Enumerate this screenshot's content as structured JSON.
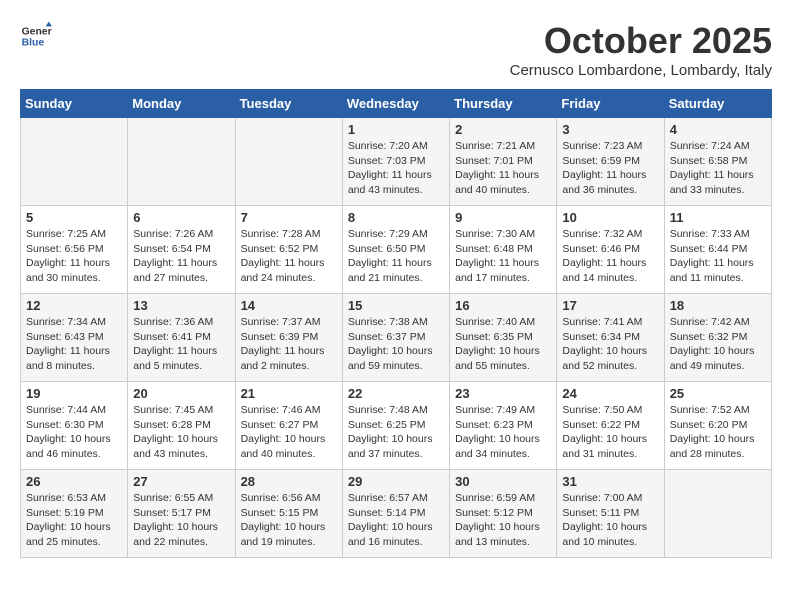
{
  "header": {
    "logo_line1": "General",
    "logo_line2": "Blue",
    "month": "October 2025",
    "location": "Cernusco Lombardone, Lombardy, Italy"
  },
  "days_of_week": [
    "Sunday",
    "Monday",
    "Tuesday",
    "Wednesday",
    "Thursday",
    "Friday",
    "Saturday"
  ],
  "weeks": [
    [
      {
        "day": "",
        "content": ""
      },
      {
        "day": "",
        "content": ""
      },
      {
        "day": "",
        "content": ""
      },
      {
        "day": "1",
        "content": "Sunrise: 7:20 AM\nSunset: 7:03 PM\nDaylight: 11 hours\nand 43 minutes."
      },
      {
        "day": "2",
        "content": "Sunrise: 7:21 AM\nSunset: 7:01 PM\nDaylight: 11 hours\nand 40 minutes."
      },
      {
        "day": "3",
        "content": "Sunrise: 7:23 AM\nSunset: 6:59 PM\nDaylight: 11 hours\nand 36 minutes."
      },
      {
        "day": "4",
        "content": "Sunrise: 7:24 AM\nSunset: 6:58 PM\nDaylight: 11 hours\nand 33 minutes."
      }
    ],
    [
      {
        "day": "5",
        "content": "Sunrise: 7:25 AM\nSunset: 6:56 PM\nDaylight: 11 hours\nand 30 minutes."
      },
      {
        "day": "6",
        "content": "Sunrise: 7:26 AM\nSunset: 6:54 PM\nDaylight: 11 hours\nand 27 minutes."
      },
      {
        "day": "7",
        "content": "Sunrise: 7:28 AM\nSunset: 6:52 PM\nDaylight: 11 hours\nand 24 minutes."
      },
      {
        "day": "8",
        "content": "Sunrise: 7:29 AM\nSunset: 6:50 PM\nDaylight: 11 hours\nand 21 minutes."
      },
      {
        "day": "9",
        "content": "Sunrise: 7:30 AM\nSunset: 6:48 PM\nDaylight: 11 hours\nand 17 minutes."
      },
      {
        "day": "10",
        "content": "Sunrise: 7:32 AM\nSunset: 6:46 PM\nDaylight: 11 hours\nand 14 minutes."
      },
      {
        "day": "11",
        "content": "Sunrise: 7:33 AM\nSunset: 6:44 PM\nDaylight: 11 hours\nand 11 minutes."
      }
    ],
    [
      {
        "day": "12",
        "content": "Sunrise: 7:34 AM\nSunset: 6:43 PM\nDaylight: 11 hours\nand 8 minutes."
      },
      {
        "day": "13",
        "content": "Sunrise: 7:36 AM\nSunset: 6:41 PM\nDaylight: 11 hours\nand 5 minutes."
      },
      {
        "day": "14",
        "content": "Sunrise: 7:37 AM\nSunset: 6:39 PM\nDaylight: 11 hours\nand 2 minutes."
      },
      {
        "day": "15",
        "content": "Sunrise: 7:38 AM\nSunset: 6:37 PM\nDaylight: 10 hours\nand 59 minutes."
      },
      {
        "day": "16",
        "content": "Sunrise: 7:40 AM\nSunset: 6:35 PM\nDaylight: 10 hours\nand 55 minutes."
      },
      {
        "day": "17",
        "content": "Sunrise: 7:41 AM\nSunset: 6:34 PM\nDaylight: 10 hours\nand 52 minutes."
      },
      {
        "day": "18",
        "content": "Sunrise: 7:42 AM\nSunset: 6:32 PM\nDaylight: 10 hours\nand 49 minutes."
      }
    ],
    [
      {
        "day": "19",
        "content": "Sunrise: 7:44 AM\nSunset: 6:30 PM\nDaylight: 10 hours\nand 46 minutes."
      },
      {
        "day": "20",
        "content": "Sunrise: 7:45 AM\nSunset: 6:28 PM\nDaylight: 10 hours\nand 43 minutes."
      },
      {
        "day": "21",
        "content": "Sunrise: 7:46 AM\nSunset: 6:27 PM\nDaylight: 10 hours\nand 40 minutes."
      },
      {
        "day": "22",
        "content": "Sunrise: 7:48 AM\nSunset: 6:25 PM\nDaylight: 10 hours\nand 37 minutes."
      },
      {
        "day": "23",
        "content": "Sunrise: 7:49 AM\nSunset: 6:23 PM\nDaylight: 10 hours\nand 34 minutes."
      },
      {
        "day": "24",
        "content": "Sunrise: 7:50 AM\nSunset: 6:22 PM\nDaylight: 10 hours\nand 31 minutes."
      },
      {
        "day": "25",
        "content": "Sunrise: 7:52 AM\nSunset: 6:20 PM\nDaylight: 10 hours\nand 28 minutes."
      }
    ],
    [
      {
        "day": "26",
        "content": "Sunrise: 6:53 AM\nSunset: 5:19 PM\nDaylight: 10 hours\nand 25 minutes."
      },
      {
        "day": "27",
        "content": "Sunrise: 6:55 AM\nSunset: 5:17 PM\nDaylight: 10 hours\nand 22 minutes."
      },
      {
        "day": "28",
        "content": "Sunrise: 6:56 AM\nSunset: 5:15 PM\nDaylight: 10 hours\nand 19 minutes."
      },
      {
        "day": "29",
        "content": "Sunrise: 6:57 AM\nSunset: 5:14 PM\nDaylight: 10 hours\nand 16 minutes."
      },
      {
        "day": "30",
        "content": "Sunrise: 6:59 AM\nSunset: 5:12 PM\nDaylight: 10 hours\nand 13 minutes."
      },
      {
        "day": "31",
        "content": "Sunrise: 7:00 AM\nSunset: 5:11 PM\nDaylight: 10 hours\nand 10 minutes."
      },
      {
        "day": "",
        "content": ""
      }
    ]
  ]
}
